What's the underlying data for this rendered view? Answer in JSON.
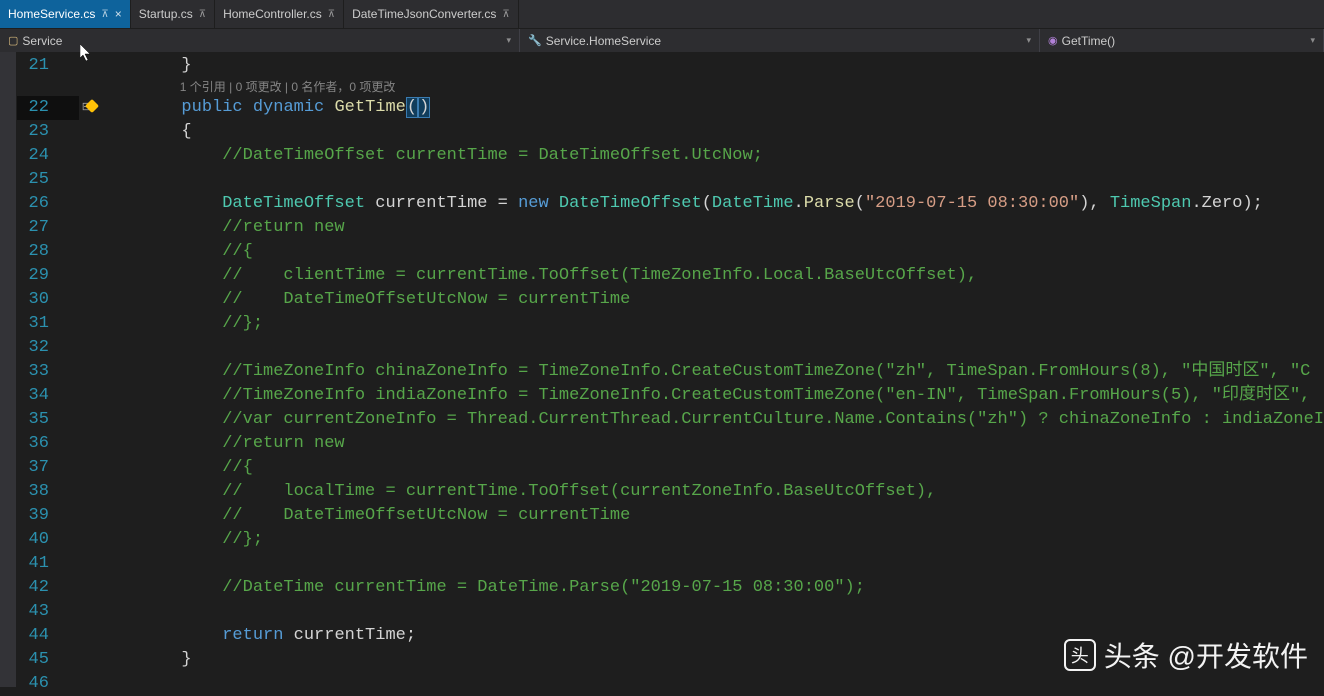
{
  "tabs": [
    {
      "label": "HomeService.cs",
      "active": true,
      "pinned": true,
      "close": true
    },
    {
      "label": "Startup.cs",
      "active": false,
      "pinned": true,
      "close": false
    },
    {
      "label": "HomeController.cs",
      "active": false,
      "pinned": true,
      "close": false
    },
    {
      "label": "DateTimeJsonConverter.cs",
      "active": false,
      "pinned": true,
      "close": false
    }
  ],
  "breadcrumb": {
    "namespace": "Service",
    "class": "Service.HomeService",
    "method": "GetTime()"
  },
  "codelens": "1 个引用 | 0 项更改 | 0 名作者，0 项更改",
  "lines": {
    "start": 21,
    "end": 46,
    "current": 22
  },
  "code": {
    "l21": "        }",
    "l22_kw1": "public",
    "l22_kw2": "dynamic",
    "l22_method": "GetTime",
    "l23": "        {",
    "l24": "            //DateTimeOffset currentTime = DateTimeOffset.UtcNow;",
    "l26_type1": "DateTimeOffset",
    "l26_var": "currentTime",
    "l26_eq": " = ",
    "l26_new": "new",
    "l26_type2": "DateTimeOffset",
    "l26_type3": "DateTime",
    "l26_parse": "Parse",
    "l26_str": "\"2019-07-15 08:30:00\"",
    "l26_type4": "TimeSpan",
    "l26_zero": "Zero",
    "l27": "            //return new",
    "l28": "            //{",
    "l29": "            //    clientTime = currentTime.ToOffset(TimeZoneInfo.Local.BaseUtcOffset),",
    "l30": "            //    DateTimeOffsetUtcNow = currentTime",
    "l31": "            //};",
    "l33": "            //TimeZoneInfo chinaZoneInfo = TimeZoneInfo.CreateCustomTimeZone(\"zh\", TimeSpan.FromHours(8), \"中国时区\", \"C",
    "l34": "            //TimeZoneInfo indiaZoneInfo = TimeZoneInfo.CreateCustomTimeZone(\"en-IN\", TimeSpan.FromHours(5), \"印度时区\",",
    "l35": "            //var currentZoneInfo = Thread.CurrentThread.CurrentCulture.Name.Contains(\"zh\") ? chinaZoneInfo : indiaZoneI",
    "l36": "            //return new",
    "l37": "            //{",
    "l38": "            //    localTime = currentTime.ToOffset(currentZoneInfo.BaseUtcOffset),",
    "l39": "            //    DateTimeOffsetUtcNow = currentTime",
    "l40": "            //};",
    "l42": "            //DateTime currentTime = DateTime.Parse(\"2019-07-15 08:30:00\");",
    "l44_ret": "return",
    "l44_var": "currentTime",
    "l45": "        }"
  },
  "watermark": "头条 @开发软件"
}
